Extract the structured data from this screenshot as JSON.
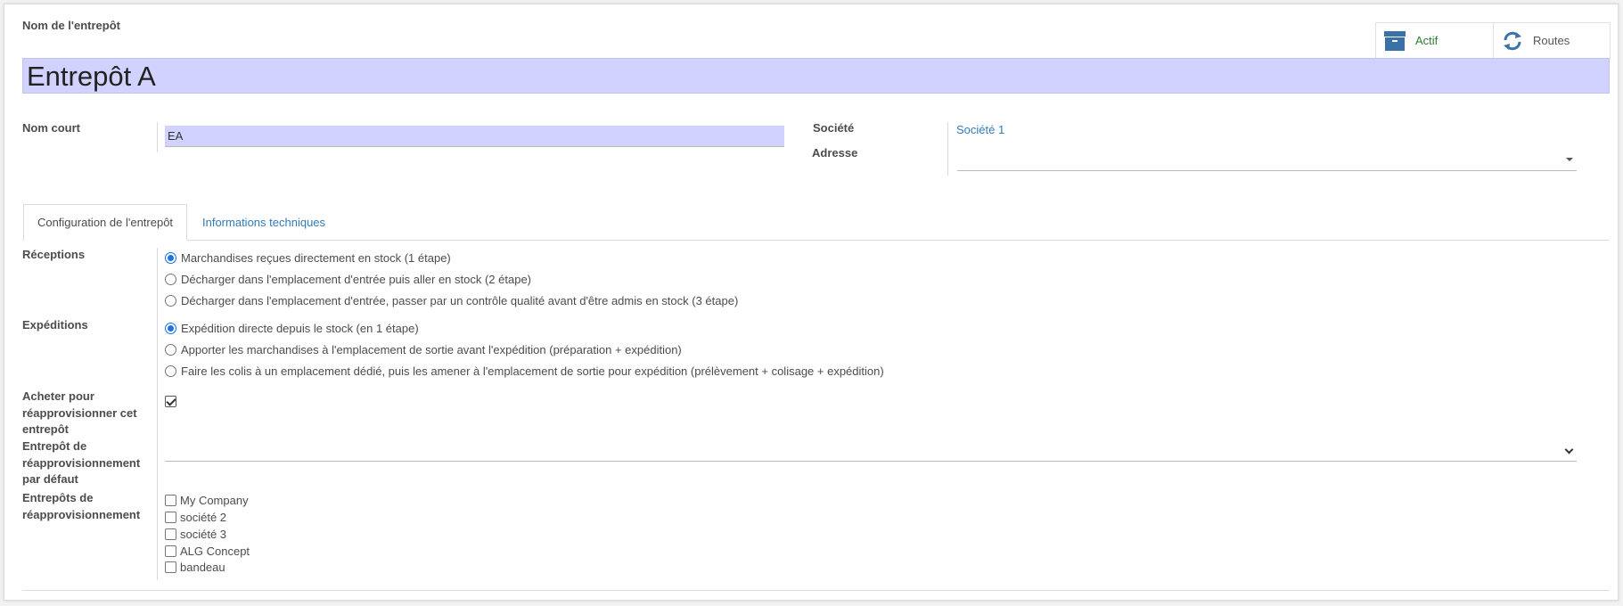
{
  "header": {
    "name_label": "Nom de l'entrepôt",
    "name_value": "Entrepôt A"
  },
  "smart_buttons": [
    {
      "label": "Actif",
      "icon": "archive-icon",
      "color": "#2e7d32"
    },
    {
      "label": "Routes",
      "icon": "refresh-icon",
      "color": "#555555"
    }
  ],
  "fields": {
    "short_name_label": "Nom court",
    "short_name_value": "EA",
    "company_label": "Société",
    "company_value": "Société 1",
    "address_label": "Adresse",
    "address_value": ""
  },
  "tabs": [
    {
      "label": "Configuration de l'entrepôt",
      "active": true
    },
    {
      "label": "Informations techniques",
      "active": false
    }
  ],
  "receptions": {
    "label": "Réceptions",
    "options": [
      {
        "label": "Marchandises reçues directement en stock (1 étape)",
        "selected": true
      },
      {
        "label": "Décharger dans l'emplacement d'entrée puis aller en stock (2 étape)",
        "selected": false
      },
      {
        "label": "Décharger dans l'emplacement d'entrée, passer par un contrôle qualité avant d'être admis en stock (3 étape)",
        "selected": false
      }
    ]
  },
  "expeditions": {
    "label": "Expéditions",
    "options": [
      {
        "label": "Expédition directe depuis le stock (en 1 étape)",
        "selected": true
      },
      {
        "label": "Apporter les marchandises à l'emplacement de sortie avant l'expédition (préparation + expédition)",
        "selected": false
      },
      {
        "label": "Faire les colis à un emplacement dédié, puis les amener à l'emplacement de sortie pour expédition (prélèvement + colisage + expédition)",
        "selected": false
      }
    ]
  },
  "buy_resupply": {
    "label_lines": [
      "Acheter pour",
      "réapprovisionner cet",
      "entrepôt"
    ],
    "checked": true
  },
  "default_resupply": {
    "label_lines": [
      "Entrepôt de",
      "réapprovisionnement",
      "par défaut"
    ],
    "value": ""
  },
  "resupply_warehouses": {
    "label_lines": [
      "Entrepôts de",
      "réapprovisionnement"
    ],
    "options": [
      {
        "label": "My Company",
        "checked": false
      },
      {
        "label": "société 2",
        "checked": false
      },
      {
        "label": "société 3",
        "checked": false
      },
      {
        "label": "ALG Concept",
        "checked": false
      },
      {
        "label": "bandeau",
        "checked": false
      }
    ]
  },
  "colors": {
    "accent_link": "#337ab7",
    "input_highlight": "#d1d2ff",
    "radio_selected": "#1a73e8"
  }
}
